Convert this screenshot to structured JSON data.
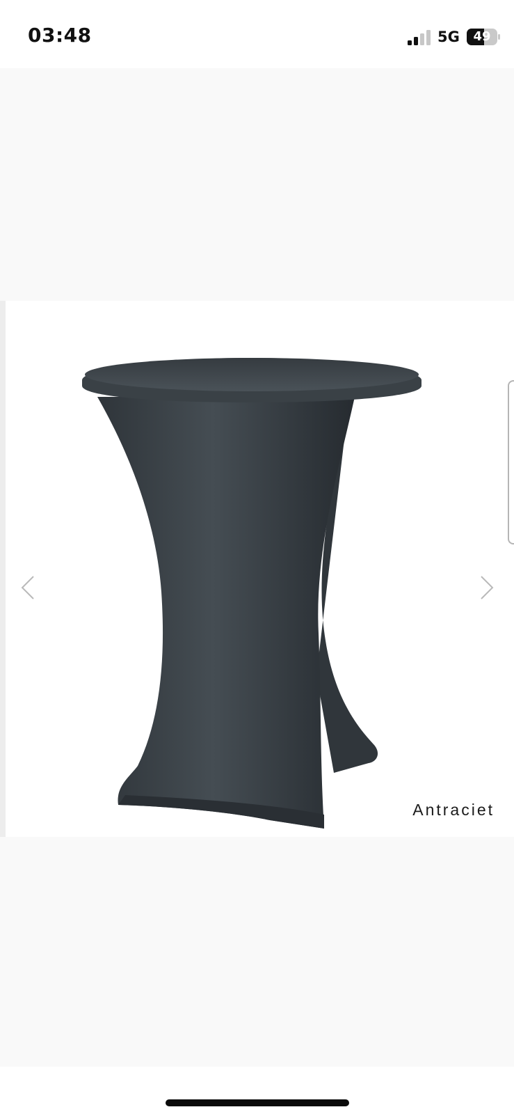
{
  "status_bar": {
    "time": "03:48",
    "network": "5G",
    "battery_level": "49",
    "signal_bars_active": 2,
    "signal_bars_total": 4
  },
  "gallery": {
    "image_icon": "product-photo-cocktail-table-cover",
    "image_color": "#3c4349",
    "prev_icon": "chevron-left-icon",
    "next_icon": "chevron-right-icon",
    "caption": "Antraciet"
  },
  "colors": {
    "page_background": "#f9f9f9",
    "gallery_background": "#ffffff",
    "cover": "#3c4349"
  }
}
